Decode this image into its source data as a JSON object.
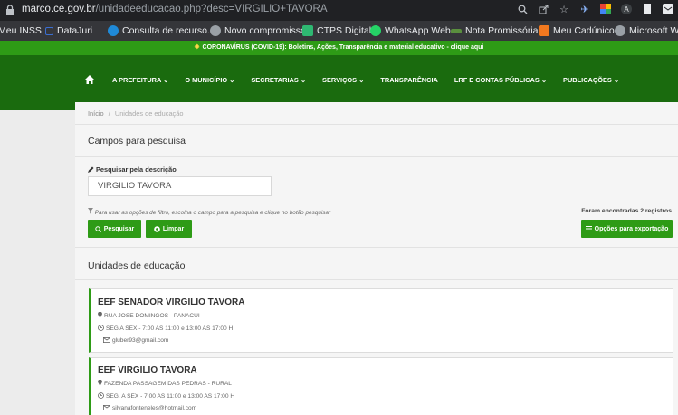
{
  "browser": {
    "url_host": "marco.ce.gov.br",
    "url_path": "/unidadeeducacao.php?desc=VIRGILIO+TAVORA",
    "bookmarks": [
      {
        "label": "Meu INSS",
        "color": "#2e7bd6"
      },
      {
        "label": "DataJuri",
        "color": "#3b6fd1"
      },
      {
        "label": "Consulta de recurso...",
        "color": "#1f8ad8"
      },
      {
        "label": "Novo compromisso",
        "color": "#9aa0a6"
      },
      {
        "label": "CTPS Digital",
        "color": "#2eb872"
      },
      {
        "label": "WhatsApp Web",
        "color": "#25d366"
      },
      {
        "label": "Nota Promissória",
        "color": "#5a8f3e"
      },
      {
        "label": "Meu Cadúnico",
        "color": "#f2791f"
      },
      {
        "label": "Microsoft Wo",
        "color": "#9aa0a6"
      }
    ]
  },
  "covid_banner": "CORONAVÍRUS (COVID-19): Boletins, Ações, Transparência e material educativo - clique aqui",
  "nav": {
    "items": [
      "A PREFEITURA ⌄",
      "O MUNICÍPIO ⌄",
      "SECRETARIAS ⌄",
      "SERVIÇOS ⌄",
      "TRANSPARÊNCIA",
      "LRF E CONTAS PÚBLICAS ⌄",
      "PUBLICAÇÕES ⌄"
    ]
  },
  "breadcrumb": {
    "home": "Início",
    "separator": "/",
    "current": "Unidades de educação"
  },
  "search": {
    "title": "Campos para pesquisa",
    "label": "Pesquisar pela descrição",
    "value": "VIRGILIO TAVORA",
    "hint": "Para usar as opções de filtro, escolha o campo para a pesquisa e clique no botão pesquisar",
    "found": "Foram encontradas 2 registros",
    "search_btn": "Pesquisar",
    "clear_btn": "Limpar",
    "export_btn": "Opções para exportação"
  },
  "units": {
    "title": "Unidades de educação",
    "items": [
      {
        "name": "EEF SENADOR VIRGILIO TAVORA",
        "address": "RUA JOSE DOMINGOS - PANACUI",
        "hours": "SEG A SEX - 7:00 AS 11:00 e 13:00 AS 17:00 H",
        "email": "gluber93@gmail.com"
      },
      {
        "name": "EEF VIRGILIO TAVORA",
        "address": "FAZENDA PASSAGEM DAS PEDRAS - RURAL",
        "hours": "SEG. A SEX - 7:00 AS 11:00 e 13:00 AS 17:00 H",
        "email": "silvanafonteneles@hotmail.com"
      }
    ]
  },
  "colors": {
    "green": "#2e9b16",
    "dark_green": "#1a6b0e"
  }
}
